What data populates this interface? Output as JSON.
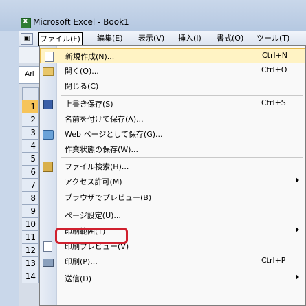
{
  "window": {
    "title": "Microsoft Excel - Book1"
  },
  "menubar": [
    {
      "label": "ファイル(F)",
      "active": true
    },
    {
      "label": "編集(E)"
    },
    {
      "label": "表示(V)"
    },
    {
      "label": "挿入(I)"
    },
    {
      "label": "書式(O)"
    },
    {
      "label": "ツール(T)"
    }
  ],
  "toolbar": {
    "font_fragment": "Ari"
  },
  "rows": [
    "1",
    "2",
    "3",
    "4",
    "5",
    "6",
    "7",
    "8",
    "9",
    "10",
    "11",
    "12",
    "13",
    "14"
  ],
  "file_menu": [
    {
      "label": "新規作成(N)...",
      "shortcut": "Ctrl+N",
      "icon": "new-document-icon",
      "highlight": true
    },
    {
      "label": "開く(O)...",
      "shortcut": "Ctrl+O",
      "icon": "open-folder-icon"
    },
    {
      "label": "閉じる(C)",
      "shortcut": ""
    },
    {
      "label": "上書き保存(S)",
      "shortcut": "Ctrl+S",
      "icon": "save-icon"
    },
    {
      "label": "名前を付けて保存(A)...",
      "shortcut": ""
    },
    {
      "label": "Web ページとして保存(G)...",
      "shortcut": "",
      "icon": "web-page-icon"
    },
    {
      "label": "作業状態の保存(W)...",
      "shortcut": ""
    },
    {
      "label": "ファイル検索(H)...",
      "shortcut": "",
      "icon": "file-search-icon"
    },
    {
      "label": "アクセス許可(M)",
      "shortcut": "",
      "submenu": true
    },
    {
      "label": "ブラウザでプレビュー(B)",
      "shortcut": ""
    },
    {
      "label": "ページ設定(U)...",
      "shortcut": "",
      "callout": true
    },
    {
      "label": "印刷範囲(T)",
      "shortcut": "",
      "submenu": true
    },
    {
      "label": "印刷プレビュー(V)",
      "shortcut": "",
      "icon": "print-preview-icon"
    },
    {
      "label": "印刷(P)...",
      "shortcut": "Ctrl+P",
      "icon": "print-icon"
    },
    {
      "label": "送信(D)",
      "shortcut": "",
      "submenu": true
    }
  ],
  "colors": {
    "highlight_bg": "#fff3c4",
    "callout_border": "#d0202e",
    "selected_row_header": "#f6c45a"
  }
}
